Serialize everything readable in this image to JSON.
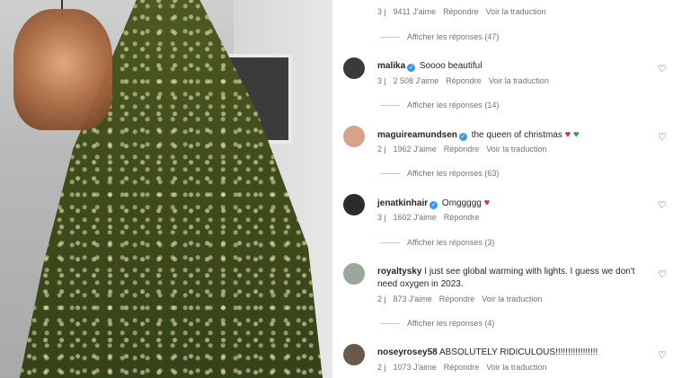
{
  "top_comment": {
    "time": "3 j",
    "likes": "9411 J'aime",
    "reply": "Répondre",
    "translate": "Voir la traduction",
    "view_replies": "Afficher les réponses (47)"
  },
  "comments": [
    {
      "username": "malika",
      "verified": true,
      "text": "Soooo beautiful",
      "time": "3 j",
      "likes": "2 508 J'aime",
      "reply": "Répondre",
      "translate": "Voir la traduction",
      "view_replies": "Afficher les réponses (14)",
      "avatar_color": "#3a3a3a"
    },
    {
      "username": "maguireamundsen",
      "verified": true,
      "text": "the queen of christmas",
      "emojis": [
        "red-heart",
        "green-heart"
      ],
      "time": "2 j",
      "likes": "1962 J'aime",
      "reply": "Répondre",
      "translate": "Voir la traduction",
      "view_replies": "Afficher les réponses (63)",
      "avatar_color": "#d9a08a"
    },
    {
      "username": "jenatkinhair",
      "verified": true,
      "text": "Omggggg",
      "emojis": [
        "red-heart"
      ],
      "time": "3 j",
      "likes": "1602 J'aime",
      "reply": "Répondre",
      "view_replies": "Afficher les réponses (3)",
      "avatar_color": "#2b2b2b"
    },
    {
      "username": "royaltysky",
      "verified": false,
      "text": "I just see global warming with lights. I guess we don't need oxygen in 2023.",
      "time": "2 j",
      "likes": "873 J'aime",
      "reply": "Répondre",
      "translate": "Voir la traduction",
      "view_replies": "Afficher les réponses (4)",
      "avatar_color": "#9aa79a"
    },
    {
      "username": "noseyrosey58",
      "verified": false,
      "text": "ABSOLUTELY RIDICULOUS!!!!!!!!!!!!!!!!!",
      "time": "2 j",
      "likes": "1073 J'aime",
      "reply": "Répondre",
      "translate": "Voir la traduction",
      "avatar_color": "#6b5a4a"
    }
  ],
  "colors": {
    "verified": "#3897f0",
    "meta_text": "#737373",
    "red_heart": "#e0245e",
    "green_heart": "#2ea043"
  }
}
